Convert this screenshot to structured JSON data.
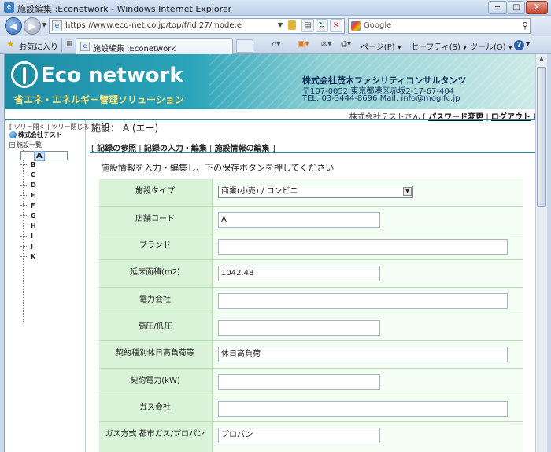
{
  "window": {
    "title": "施設編集 :Econetwork - Windows Internet Explorer",
    "minimize": "─",
    "maximize": "□",
    "close": "X"
  },
  "address": {
    "url": "https://www.eco-net.co.jp/top/f/id:27/mode:e",
    "search_placeholder": "Google"
  },
  "favorites": {
    "label": "お気に入り"
  },
  "tab": {
    "title": "施設編集 :Econetwork"
  },
  "commandbar": {
    "page": "ページ(P)",
    "safety": "セーフティ(S)",
    "tools": "ツール(O)",
    "help": "?"
  },
  "banner": {
    "logo": "Eco network",
    "slogan": "省エネ・エネルギー管理ソリューション",
    "company": "株式会社茂木ファシリティコンサルタンツ",
    "address": "〒107-0052 東京都港区赤坂2-17-67-404",
    "contact": "TEL: 03-3444-8696 Mail: info@mogifc.jp"
  },
  "userbar": {
    "user": "株式会社テストさん",
    "password_link": "パスワード変更",
    "logout_link": "ログアウト"
  },
  "sidebar": {
    "tree_open": "ツリー開く",
    "tree_close": "ツリー閉じる",
    "root": "株式会社テスト",
    "facilities": "施設一覧",
    "items": [
      "A",
      "B",
      "C",
      "D",
      "E",
      "F",
      "G",
      "H",
      "I",
      "J",
      "K"
    ],
    "selected": "A"
  },
  "main": {
    "crumb": "施設：  A  (エー)",
    "nav": {
      "view": "記録の参照",
      "input": "記録の入力・編集",
      "facility": "施設情報の編集"
    },
    "instruction": "施設情報を入力・編集し、下の保存ボタンを押してください"
  },
  "form": {
    "fields": [
      {
        "label": "施設タイプ",
        "value": "商業(小売) / コンビニ"
      },
      {
        "label": "店舗コード",
        "value": "A"
      },
      {
        "label": "ブランド",
        "value": ""
      },
      {
        "label": "延床面積(m2)",
        "value": "1042.48"
      },
      {
        "label": "電力会社",
        "value": ""
      },
      {
        "label": "高圧/低圧",
        "value": ""
      },
      {
        "label": "契約種別休日高負荷等",
        "value": "休日高負荷"
      },
      {
        "label": "契約電力(kW)",
        "value": ""
      },
      {
        "label": "ガス会社",
        "value": ""
      },
      {
        "label": "ガス方式 都市ガス/プロパン",
        "value": "プロパン"
      }
    ]
  }
}
